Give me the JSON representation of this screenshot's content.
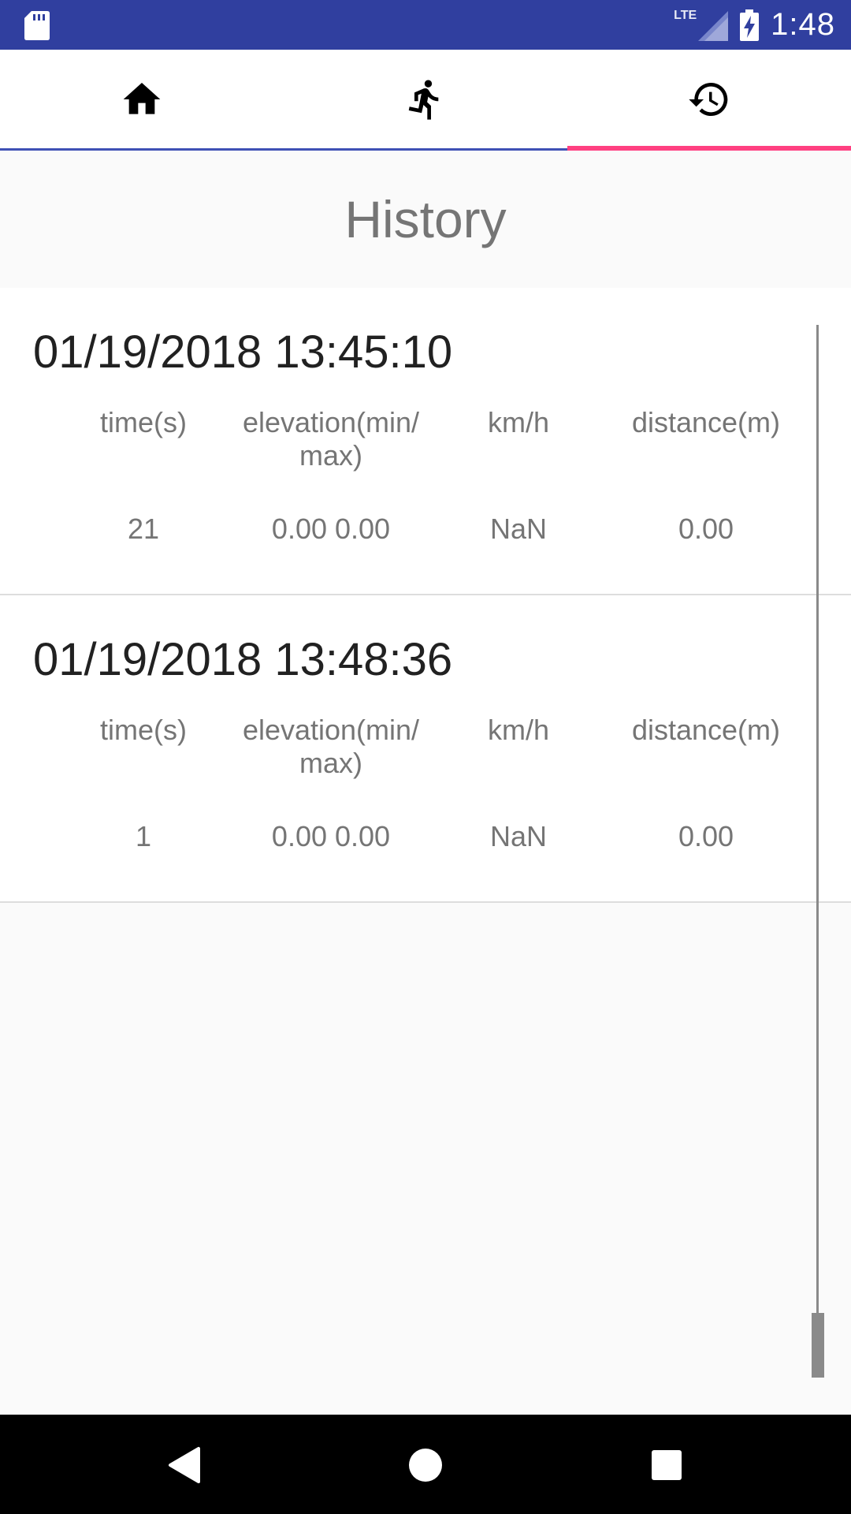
{
  "status_bar": {
    "network_label": "LTE",
    "time": "1:48"
  },
  "tabs": [
    {
      "name": "home",
      "icon": "home-icon",
      "selected": false
    },
    {
      "name": "run",
      "icon": "running-person-icon",
      "selected": false
    },
    {
      "name": "history",
      "icon": "history-icon",
      "selected": true
    }
  ],
  "page": {
    "title": "History"
  },
  "columns": [
    "time(s)",
    "elevation(min/\nmax)",
    "km/h",
    "distance(m)"
  ],
  "history": [
    {
      "date": "01/19/2018 13:45:10",
      "time": "21",
      "elevation": "0.00 0.00",
      "speed": "NaN",
      "distance": "0.00"
    },
    {
      "date": "01/19/2018 13:48:36",
      "time": "1",
      "elevation": "0.00 0.00",
      "speed": "NaN",
      "distance": "0.00"
    }
  ],
  "colors": {
    "status_bar": "#303f9f",
    "tab_indicator": "#ff4081",
    "tab_underline": "#3f51b5"
  }
}
